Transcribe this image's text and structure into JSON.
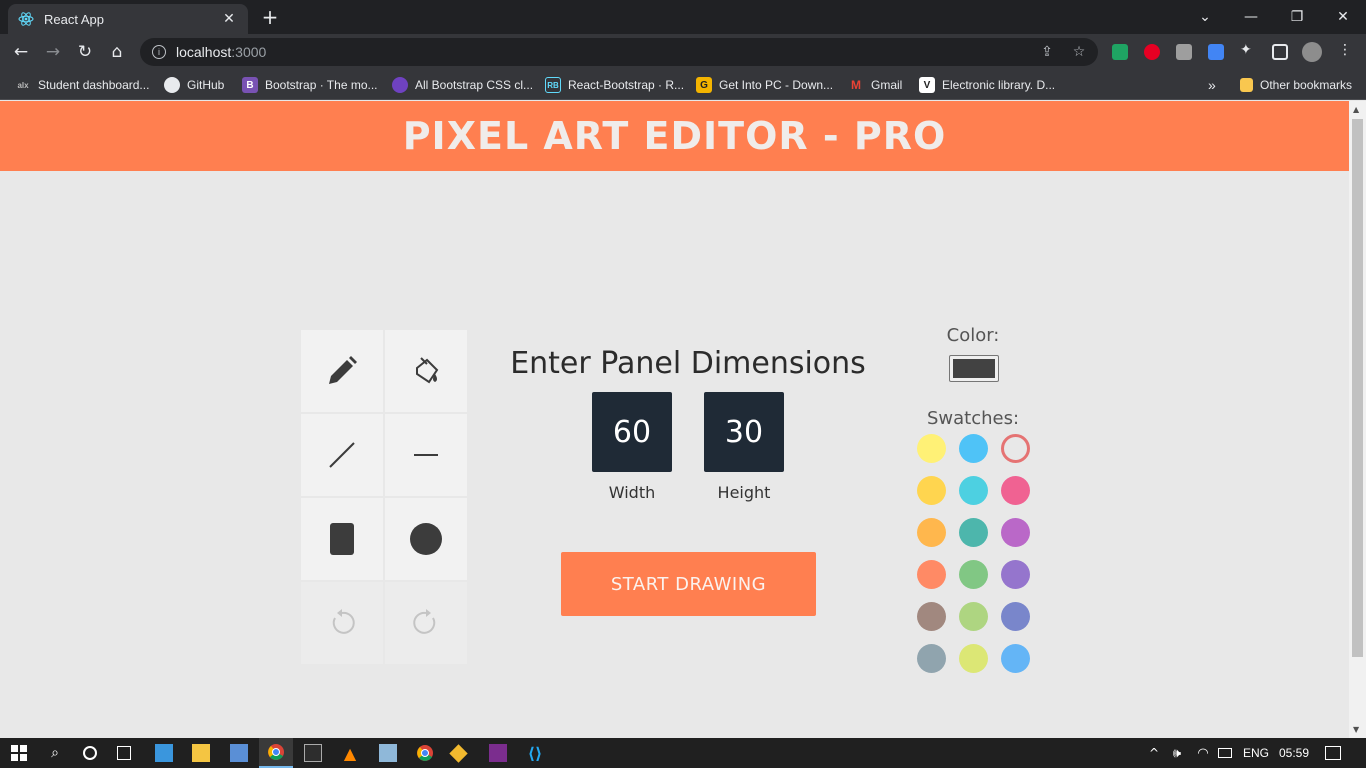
{
  "browser": {
    "tab_title": "React App",
    "url_host": "localhost",
    "url_port": ":3000"
  },
  "bookmarks": [
    {
      "label": "Student dashboard...",
      "icon": "alx-icon"
    },
    {
      "label": "GitHub",
      "icon": "github-icon"
    },
    {
      "label": "Bootstrap · The mo...",
      "icon": "bootstrap-icon"
    },
    {
      "label": "All Bootstrap CSS cl...",
      "icon": "circle-icon"
    },
    {
      "label": "React-Bootstrap · R...",
      "icon": "react-bootstrap-icon"
    },
    {
      "label": "Get Into PC - Down...",
      "icon": "getintopc-icon"
    },
    {
      "label": "Gmail",
      "icon": "gmail-icon"
    },
    {
      "label": "Electronic library. D...",
      "icon": "library-icon"
    }
  ],
  "other_bookmarks": "Other bookmarks",
  "app": {
    "title": "PIXEL ART EDITOR - PRO",
    "dimensions_title": "Enter Panel Dimensions",
    "width_value": "60",
    "height_value": "30",
    "width_label": "Width",
    "height_label": "Height",
    "start_label": "START DRAWING",
    "color_label": "Color:",
    "swatches_label": "Swatches:",
    "current_color": "#424242",
    "accent": "#ff7f50",
    "swatches": [
      [
        "#fff176",
        "#4fc3f7",
        "#e57373"
      ],
      [
        "#ffd54f",
        "#4dd0e1",
        "#f06292"
      ],
      [
        "#ffb74d",
        "#4db6ac",
        "#ba68c8"
      ],
      [
        "#ff8a65",
        "#81c784",
        "#9575cd"
      ],
      [
        "#a1887f",
        "#aed581",
        "#7986cb"
      ],
      [
        "#90a4ae",
        "#dce775",
        "#64b5f6"
      ]
    ],
    "selected_swatch": "#e57373",
    "tools": [
      "pencil-icon",
      "bucket-icon",
      "line-icon",
      "horizontal-line-icon",
      "rectangle-icon",
      "circle-icon",
      "undo-icon",
      "redo-icon"
    ]
  },
  "taskbar": {
    "language": "ENG",
    "time": "05:59"
  }
}
